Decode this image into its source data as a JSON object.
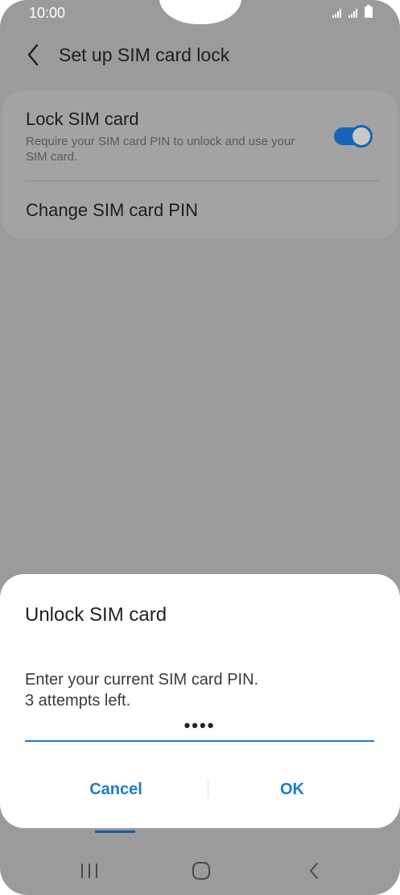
{
  "status_bar": {
    "time": "10:00"
  },
  "header": {
    "title": "Set up SIM card lock"
  },
  "settings": {
    "lock_sim": {
      "title": "Lock SIM card",
      "subtitle": "Require your SIM card PIN to unlock and use your SIM card.",
      "enabled": true
    },
    "change_pin": {
      "title": "Change SIM card PIN"
    }
  },
  "dialog": {
    "title": "Unlock SIM card",
    "message_line1": "Enter your current SIM card PIN.",
    "message_line2": "3 attempts left.",
    "pin_value": "••••",
    "cancel_label": "Cancel",
    "ok_label": "OK"
  },
  "colors": {
    "accent": "#1b7ccb",
    "toggle": "#1465b6",
    "scrim": "#9b9b9b"
  },
  "navigation": {
    "icons": [
      "recent-apps-icon",
      "home-icon",
      "back-icon"
    ]
  }
}
